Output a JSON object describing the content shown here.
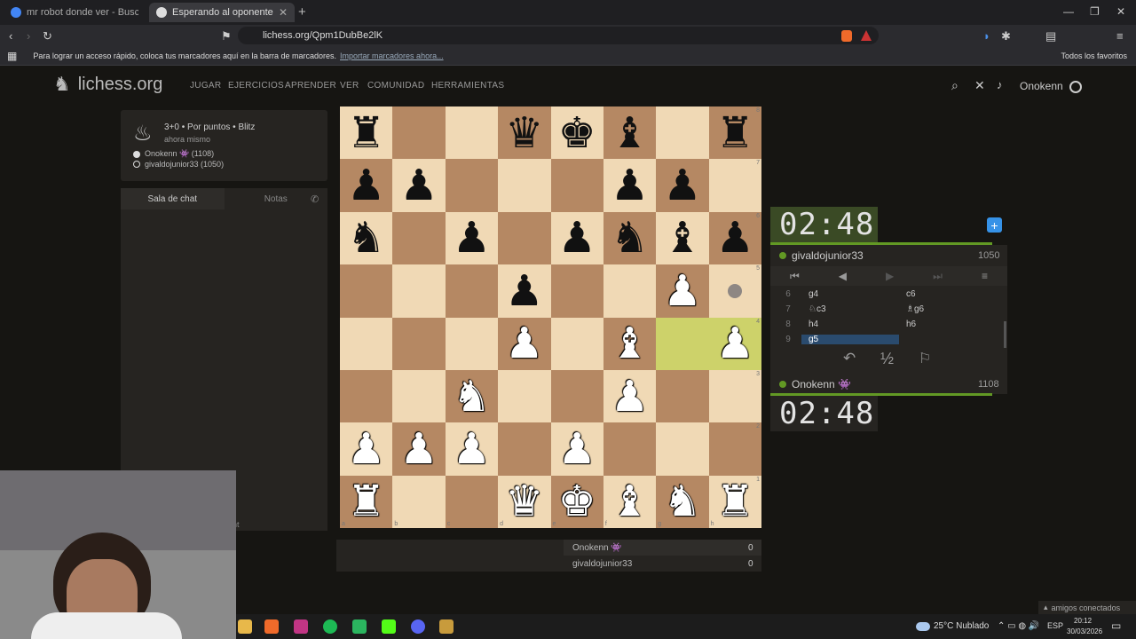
{
  "browser": {
    "tabs": [
      {
        "label": "mr robot donde ver - Buscar con Go",
        "active": false
      },
      {
        "label": "Esperando al oponente - Jug",
        "active": true
      }
    ],
    "new_tab": "+",
    "url": "lichess.org/Qpm1DubBe2lK",
    "bookmark_bar_text": "Para lograr un acceso rápido, coloca tus marcadores aquí en la barra de marcadores.",
    "bookmark_bar_link": "Importar marcadores ahora...",
    "all_favorites": "Todos los favoritos"
  },
  "site": {
    "logo": "lichess.org",
    "nav": [
      "JUGAR",
      "EJERCICIOS",
      "APRENDER",
      "VER",
      "COMUNIDAD",
      "HERRAMIENTAS"
    ],
    "username": "Onokenn"
  },
  "game_info": {
    "mode": "3+0 • Por puntos • Blitz",
    "time": "ahora mismo",
    "white_player": "Onokenn 👾 (1108)",
    "black_player": "givaldojunior33 (1050)"
  },
  "chat": {
    "tab_chat": "Sala de chat",
    "tab_notes": "Notas",
    "partial_text": "nt"
  },
  "board": {
    "ranks": [
      [
        "bR",
        "",
        "",
        "bQ",
        "bK",
        "bB",
        "",
        "bR"
      ],
      [
        "bP",
        "bP",
        "",
        "",
        "",
        "bP",
        "bP",
        ""
      ],
      [
        "bN",
        "",
        "bP",
        "",
        "bP",
        "bN",
        "bB",
        "bP"
      ],
      [
        "",
        "",
        "",
        "bP",
        "",
        "",
        "wP",
        "dot"
      ],
      [
        "",
        "",
        "",
        "wP",
        "",
        "wB",
        "hl",
        "wP-hl"
      ],
      [
        "",
        "",
        "wN",
        "",
        "",
        "wP",
        "",
        ""
      ],
      [
        "wP",
        "wP",
        "wP",
        "",
        "wP",
        "",
        "",
        ""
      ],
      [
        "wR",
        "",
        "",
        "wQ",
        "wK",
        "wB",
        "wN",
        "wR"
      ]
    ],
    "rank_labels": [
      "8",
      "7",
      "6",
      "5",
      "4",
      "3",
      "2",
      "1"
    ],
    "file_labels": [
      "a",
      "b",
      "c",
      "d",
      "e",
      "f",
      "g",
      "h"
    ]
  },
  "opponent": {
    "name": "givaldojunior33",
    "rating": "1050",
    "clock": "02:48"
  },
  "player": {
    "name": "Onokenn 👾",
    "rating": "1108",
    "clock": "02:48"
  },
  "moves": [
    {
      "n": "6",
      "w": "g4",
      "b": "c6"
    },
    {
      "n": "7",
      "w": "♘c3",
      "b": "♗g6"
    },
    {
      "n": "8",
      "w": "h4",
      "b": "h6"
    },
    {
      "n": "9",
      "w": "g5",
      "b": ""
    }
  ],
  "controls": {
    "draw": "½"
  },
  "scoreboard": [
    {
      "name": "Onokenn 👾",
      "score": "0"
    },
    {
      "name": "givaldojunior33",
      "score": "0"
    }
  ],
  "taskbar": {
    "weather": "25°C Nublado",
    "lang": "ESP",
    "time": "20:12",
    "date": "30/03/2026",
    "friends": "amigos conectados"
  },
  "colors": {
    "light_square": "#f0d9b5",
    "dark_square": "#b58863",
    "highlight": "#cdd26a",
    "online_green": "#629924"
  }
}
